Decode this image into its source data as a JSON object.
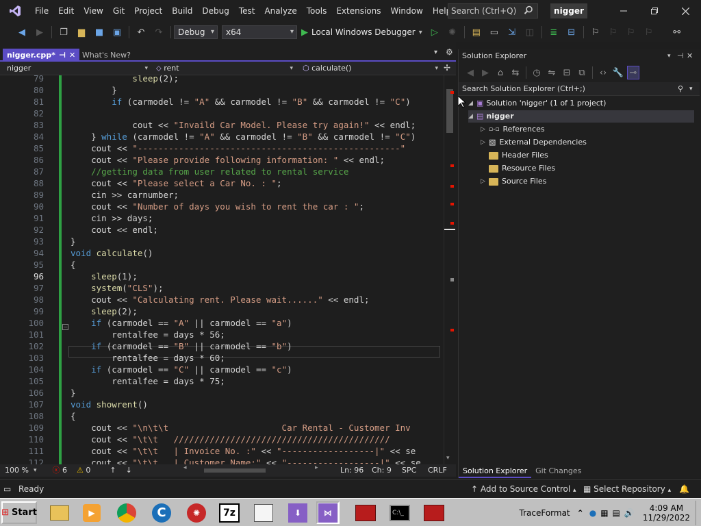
{
  "menu": {
    "items": [
      "File",
      "Edit",
      "View",
      "Git",
      "Project",
      "Build",
      "Debug",
      "Test",
      "Analyze",
      "Tools",
      "Extensions",
      "Window",
      "Help"
    ]
  },
  "titlebar": {
    "search_placeholder": "Search (Ctrl+Q)",
    "project_name": "nigger"
  },
  "toolbar": {
    "config": "Debug",
    "platform": "x64",
    "run_label": "Local Windows Debugger"
  },
  "tabs": {
    "active": "nigger.cpp*",
    "inactive": "What's New?"
  },
  "navbar": {
    "project": "nigger",
    "scope": "rent",
    "member": "calculate()"
  },
  "code": {
    "lines": [
      {
        "n": "79",
        "html": "            <span class=\"fn\">sleep</span>(2);"
      },
      {
        "n": "80",
        "html": "        }"
      },
      {
        "n": "81",
        "html": "        <span class=\"kw\">if</span> (carmodel != <span class=\"st\">\"A\"</span> &amp;&amp; carmodel != <span class=\"st\">\"B\"</span> &amp;&amp; carmodel != <span class=\"st\">\"C\"</span>)"
      },
      {
        "n": "82",
        "html": ""
      },
      {
        "n": "83",
        "html": "            cout &lt;&lt; <span class=\"st\">\"Invaild Car Model. Please try again!\"</span> &lt;&lt; endl;"
      },
      {
        "n": "84",
        "html": "    } <span class=\"kw\">while</span> (carmodel != <span class=\"st\">\"A\"</span> &amp;&amp; carmodel != <span class=\"st\">\"B\"</span> &amp;&amp; carmodel != <span class=\"st\">\"C\"</span>)"
      },
      {
        "n": "85",
        "html": "    cout &lt;&lt; <span class=\"st\">\"---------------------------------------------------\"</span>"
      },
      {
        "n": "86",
        "html": "    cout &lt;&lt; <span class=\"st\">\"Please provide following information: \"</span> &lt;&lt; endl;"
      },
      {
        "n": "87",
        "html": "    <span class=\"cm\">//getting data from user related to rental service</span>"
      },
      {
        "n": "88",
        "html": "    cout &lt;&lt; <span class=\"st\">\"Please select a Car No. : \"</span>;"
      },
      {
        "n": "89",
        "html": "    cin &gt;&gt; carnumber;"
      },
      {
        "n": "90",
        "html": "    cout &lt;&lt; <span class=\"st\">\"Number of days you wish to rent the car : \"</span>;"
      },
      {
        "n": "91",
        "html": "    cin &gt;&gt; days;"
      },
      {
        "n": "92",
        "html": "    cout &lt;&lt; endl;"
      },
      {
        "n": "93",
        "html": "}"
      },
      {
        "n": "94",
        "html": "<span class=\"kw\">void</span> <span class=\"fn\">calculate</span>()"
      },
      {
        "n": "95",
        "html": "{"
      },
      {
        "n": "96",
        "html": "    <span class=\"fn\">sleep</span>(1);"
      },
      {
        "n": "97",
        "html": "    <span class=\"fn\">system</span>(<span class=\"st\">\"CLS\"</span>);"
      },
      {
        "n": "98",
        "html": "    cout &lt;&lt; <span class=\"st\">\"Calculating rent. Please wait......\"</span> &lt;&lt; endl;"
      },
      {
        "n": "99",
        "html": "    <span class=\"fn\">sleep</span>(2);"
      },
      {
        "n": "100",
        "html": "    <span class=\"kw\">if</span> (carmodel == <span class=\"st\">\"A\"</span> || carmodel == <span class=\"st\">\"a\"</span>)"
      },
      {
        "n": "101",
        "html": "        rentalfee = days * 56;"
      },
      {
        "n": "102",
        "html": "    <span class=\"kw\">if</span> (carmodel == <span class=\"st\">\"B\"</span> || carmodel == <span class=\"st\">\"b\"</span>)"
      },
      {
        "n": "103",
        "html": "        rentalfee = days * 60;"
      },
      {
        "n": "104",
        "html": "    <span class=\"kw\">if</span> (carmodel == <span class=\"st\">\"C\"</span> || carmodel == <span class=\"st\">\"c\"</span>)"
      },
      {
        "n": "105",
        "html": "        rentalfee = days * 75;"
      },
      {
        "n": "106",
        "html": "}"
      },
      {
        "n": "107",
        "html": "<span class=\"kw\">void</span> <span class=\"fn\">showrent</span>()"
      },
      {
        "n": "108",
        "html": "{"
      },
      {
        "n": "109",
        "html": "    cout &lt;&lt; <span class=\"st\">\"\\n\\t\\t                      Car Rental - Customer Inv</span>"
      },
      {
        "n": "110",
        "html": "    cout &lt;&lt; <span class=\"st\">\"\\t\\t   //////////////////////////////////////////</span>"
      },
      {
        "n": "111",
        "html": "    cout &lt;&lt; <span class=\"st\">\"\\t\\t   | Invoice No. :\"</span> &lt;&lt; <span class=\"st\">\"------------------|\"</span> &lt;&lt; se"
      },
      {
        "n": "112",
        "html": "    cout &lt;&lt; <span class=\"st\">\"\\t\\t   | Customer Name:\"</span> &lt;&lt; <span class=\"st\">\"------------------|\"</span> &lt;&lt; se"
      }
    ],
    "current_line": "96"
  },
  "editor_status": {
    "zoom": "100 %",
    "errors": "6",
    "warnings": "0",
    "ln": "Ln: 96",
    "ch": "Ch: 9",
    "spc": "SPC",
    "crlf": "CRLF"
  },
  "solution_explorer": {
    "title": "Solution Explorer",
    "search_placeholder": "Search Solution Explorer (Ctrl+;)",
    "solution_label": "Solution 'nigger' (1 of 1 project)",
    "project": "nigger",
    "items": [
      "References",
      "External Dependencies",
      "Header Files",
      "Resource Files",
      "Source Files"
    ],
    "bottom_tabs": [
      "Solution Explorer",
      "Git Changes"
    ]
  },
  "statusbar": {
    "ready": "Ready",
    "add_source": "Add to Source Control",
    "select_repo": "Select Repository"
  },
  "taskbar": {
    "start": "Start",
    "tray_label": "TraceFormat",
    "time": "4:09 AM",
    "date": "11/29/2022"
  },
  "colors": {
    "accent": "#5b4cc4",
    "error": "#e51400",
    "git_change": "#2ea043"
  }
}
